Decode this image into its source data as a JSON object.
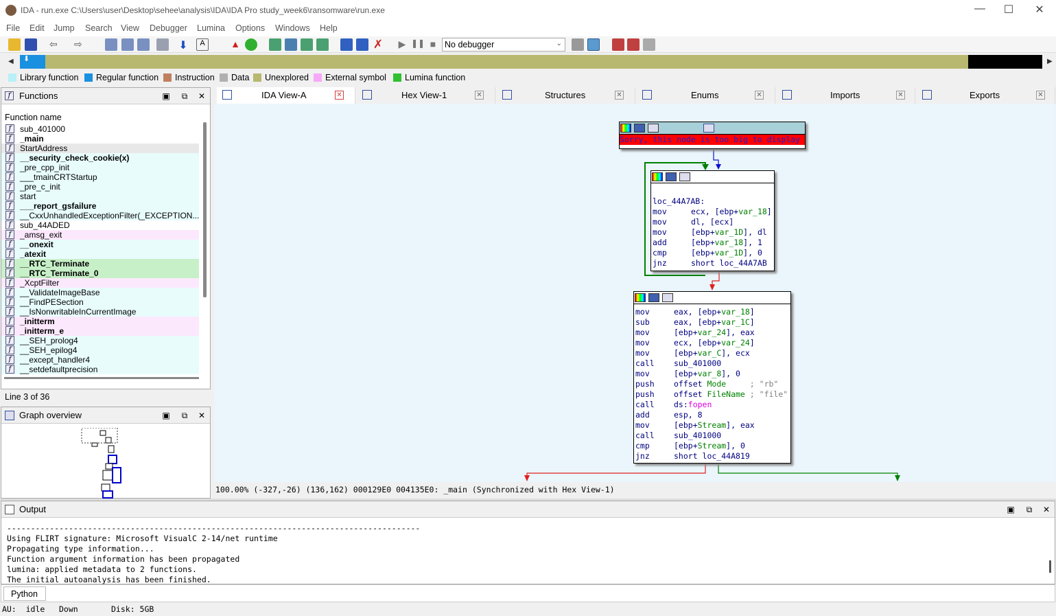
{
  "window": {
    "title": "IDA - run.exe C:\\Users\\user\\Desktop\\sehee\\analysis\\IDA\\IDA Pro study_week6\\ransomware\\run.exe"
  },
  "menu": [
    "File",
    "Edit",
    "Jump",
    "Search",
    "View",
    "Debugger",
    "Lumina",
    "Options",
    "Windows",
    "Help"
  ],
  "toolbar": {
    "debugger_select": "No debugger"
  },
  "legend": [
    {
      "label": "Library function",
      "color": "#b8f0f8"
    },
    {
      "label": "Regular function",
      "color": "#1a90e0"
    },
    {
      "label": "Instruction",
      "color": "#c08060"
    },
    {
      "label": "Data",
      "color": "#b0b0b0"
    },
    {
      "label": "Unexplored",
      "color": "#b8b870"
    },
    {
      "label": "External symbol",
      "color": "#f8a8f8"
    },
    {
      "label": "Lumina function",
      "color": "#30c030"
    }
  ],
  "functions": {
    "title": "Functions",
    "column": "Function name",
    "items": [
      {
        "name": "sub_401000",
        "bold": false,
        "bg": "#ffffff"
      },
      {
        "name": "_main",
        "bold": true,
        "bg": "#ffffff"
      },
      {
        "name": "StartAddress",
        "bold": false,
        "bg": "#e8e8e8"
      },
      {
        "name": "__security_check_cookie(x)",
        "bold": true,
        "bg": "#e8fcfc"
      },
      {
        "name": "_pre_cpp_init",
        "bold": false,
        "bg": "#e8fcfc"
      },
      {
        "name": "___tmainCRTStartup",
        "bold": false,
        "bg": "#e8fcfc"
      },
      {
        "name": "_pre_c_init",
        "bold": false,
        "bg": "#e8fcfc"
      },
      {
        "name": "start",
        "bold": false,
        "bg": "#e8fcfc"
      },
      {
        "name": "___report_gsfailure",
        "bold": true,
        "bg": "#e8fcfc"
      },
      {
        "name": "__CxxUnhandledExceptionFilter(_EXCEPTION...",
        "bold": false,
        "bg": "#e8fcfc"
      },
      {
        "name": "sub_44ADED",
        "bold": false,
        "bg": "#ffffff"
      },
      {
        "name": "_amsg_exit",
        "bold": false,
        "bg": "#fce8fc"
      },
      {
        "name": "__onexit",
        "bold": true,
        "bg": "#e8fcfc"
      },
      {
        "name": "_atexit",
        "bold": true,
        "bg": "#e8fcfc"
      },
      {
        "name": "__RTC_Terminate",
        "bold": true,
        "bg": "#c8f0c8"
      },
      {
        "name": "__RTC_Terminate_0",
        "bold": true,
        "bg": "#c8f0c8"
      },
      {
        "name": "_XcptFilter",
        "bold": false,
        "bg": "#fce8fc"
      },
      {
        "name": "__ValidateImageBase",
        "bold": false,
        "bg": "#e8fcfc"
      },
      {
        "name": "__FindPESection",
        "bold": false,
        "bg": "#e8fcfc"
      },
      {
        "name": "__IsNonwritableInCurrentImage",
        "bold": false,
        "bg": "#e8fcfc"
      },
      {
        "name": "_initterm",
        "bold": true,
        "bg": "#fce8fc"
      },
      {
        "name": "_initterm_e",
        "bold": true,
        "bg": "#fce8fc"
      },
      {
        "name": "__SEH_prolog4",
        "bold": false,
        "bg": "#e8fcfc"
      },
      {
        "name": "__SEH_epilog4",
        "bold": false,
        "bg": "#e8fcfc"
      },
      {
        "name": "__except_handler4",
        "bold": false,
        "bg": "#e8fcfc"
      },
      {
        "name": "__setdefaultprecision",
        "bold": false,
        "bg": "#e8fcfc"
      }
    ],
    "status": "Line 3 of 36"
  },
  "graph_overview": {
    "title": "Graph overview"
  },
  "tabs": [
    "IDA View-A",
    "Hex View-1",
    "Structures",
    "Enums",
    "Imports",
    "Exports"
  ],
  "graph": {
    "node1": {
      "error": "Sorry, this node is too big to display"
    },
    "node2": {
      "label": "loc_44A7AB:",
      "lines": [
        {
          "m": "mov",
          "o": "ecx, [ebp+var_18]"
        },
        {
          "m": "mov",
          "o": "dl, [ecx]"
        },
        {
          "m": "mov",
          "o": "[ebp+var_1D], dl"
        },
        {
          "m": "add",
          "o": "[ebp+var_18], 1"
        },
        {
          "m": "cmp",
          "o": "[ebp+var_1D], 0"
        },
        {
          "m": "jnz",
          "o": "short loc_44A7AB"
        }
      ]
    },
    "node3": {
      "lines": [
        {
          "m": "mov",
          "o": "eax, [ebp+var_18]"
        },
        {
          "m": "sub",
          "o": "eax, [ebp+var_1C]"
        },
        {
          "m": "mov",
          "o": "[ebp+var_24], eax"
        },
        {
          "m": "mov",
          "o": "ecx, [ebp+var_24]"
        },
        {
          "m": "mov",
          "o": "[ebp+var_C], ecx"
        },
        {
          "m": "call",
          "o": "sub_401000"
        },
        {
          "m": "mov",
          "o": "[ebp+var_8], 0"
        },
        {
          "m": "push",
          "o": "offset Mode     ; \"rb\""
        },
        {
          "m": "push",
          "o": "offset FileName ; \"file\""
        },
        {
          "m": "call",
          "o": "ds:fopen"
        },
        {
          "m": "add",
          "o": "esp, 8"
        },
        {
          "m": "mov",
          "o": "[ebp+Stream], eax"
        },
        {
          "m": "call",
          "o": "sub_401000"
        },
        {
          "m": "cmp",
          "o": "[ebp+Stream], 0"
        },
        {
          "m": "jnz",
          "o": "short loc_44A819"
        }
      ]
    },
    "status": "100.00% (-327,-26) (136,162) 000129E0 004135E0: _main (Synchronized with Hex View-1)"
  },
  "output": {
    "title": "Output",
    "lines": [
      "---------------------------------------------------------------------------------------",
      "Using FLIRT signature: Microsoft VisualC 2-14/net runtime",
      "Propagating type information...",
      "Function argument information has been propagated",
      "lumina: applied metadata to 2 functions.",
      "The initial autoanalysis has been finished."
    ],
    "python_label": "Python"
  },
  "statusbar": {
    "au": "AU:  idle",
    "dir": "Down",
    "disk": "Disk: 5GB"
  }
}
